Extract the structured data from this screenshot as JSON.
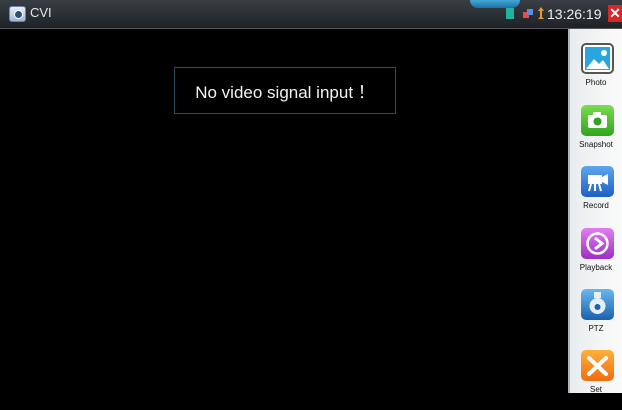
{
  "titlebar": {
    "app_title": "CVI",
    "close_glyph": "✕"
  },
  "status": {
    "time": "13:26:19",
    "icons": [
      "sd-card-icon",
      "network-icon",
      "usb-icon"
    ]
  },
  "video": {
    "message": "No video signal input ！"
  },
  "sidebar": {
    "items": [
      {
        "label": "Photo",
        "icon": "photo-icon"
      },
      {
        "label": "Snapshot",
        "icon": "camera-icon"
      },
      {
        "label": "Record",
        "icon": "video-record-icon"
      },
      {
        "label": "Playback",
        "icon": "play-icon"
      },
      {
        "label": "PTZ",
        "icon": "ptz-camera-icon"
      },
      {
        "label": "Set",
        "icon": "tools-icon"
      }
    ]
  },
  "colors": {
    "close": "#d8262a",
    "accent_blue": "#1b6fa2",
    "sd_icon": "#1fb4a1"
  }
}
